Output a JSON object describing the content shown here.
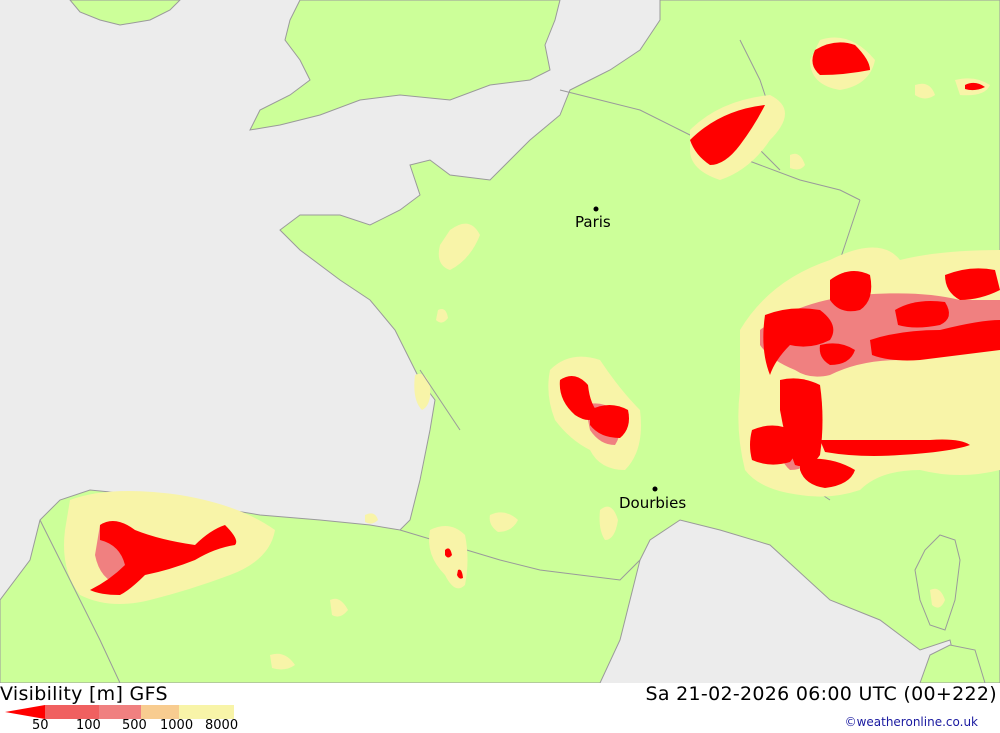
{
  "map": {
    "cities": [
      {
        "name": "Paris"
      },
      {
        "name": "Dourbies"
      }
    ]
  },
  "footer": {
    "title": "Visibility [m] GFS",
    "datetime": "Sa 21-02-2026 06:00 UTC (00+222)",
    "credit": "©weatheronline.co.uk",
    "scale_ticks": [
      "50",
      "100",
      "500",
      "1000",
      "8000"
    ]
  },
  "colors": {
    "sea": "#ececec",
    "land": "#ccff99",
    "pale_yellow": "#f8f4a8",
    "pink": "#f08080",
    "red": "#ff0000",
    "coastline": "#9a9a9a"
  }
}
